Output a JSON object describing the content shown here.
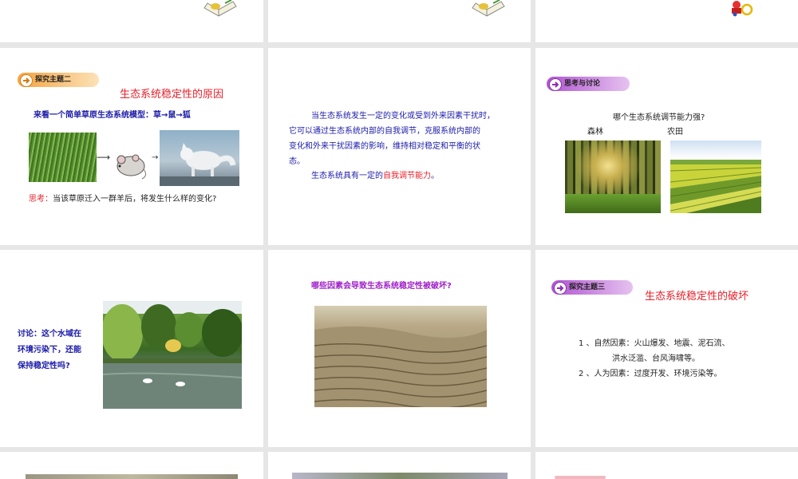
{
  "colors": {
    "topic_title_red": "#e8202a",
    "body_blue": "#1a1aa8",
    "question_purple": "#a020c8",
    "discussion_red": "#e8202a",
    "banner_orange": "#f5a340",
    "banner_purple": "#b054d0"
  },
  "slide4": {
    "banner": "探究主题二",
    "title": "生态系统稳定性的原因",
    "model_text": "来看一个简单草原生态系统模型：草→鼠→狐",
    "arrow1": "⟶",
    "arrow2": "→",
    "think_label": "思考：",
    "think_text": "当该草原迁入一群羊后，将发生什么样的变化?"
  },
  "slide5": {
    "para1_line1": "当生态系统发生一定的变化或受到外来因素干扰时，",
    "para1_line2": "它可以通过生态系统内部的自我调节，克服系统内部的",
    "para1_line3": "变化和外来干扰因素的影响，维持相对稳定和平衡的状",
    "para1_line4": "态。",
    "para2_prefix": "生态系统具有一定的",
    "para2_highlight": "自我调节能力",
    "para2_suffix": "。"
  },
  "slide6": {
    "banner": "思考与讨论",
    "question": "哪个生态系统调节能力强?",
    "label_forest": "森林",
    "label_farm": "农田"
  },
  "slide7": {
    "line1": "讨论：这个水域在",
    "line2": "环境污染下，还能",
    "line3": "保持稳定性吗?"
  },
  "slide8": {
    "question": "哪些因素会导致生态系统稳定性被破坏?"
  },
  "slide9": {
    "banner": "探究主题三",
    "title": "生态系统稳定性的破坏",
    "item1_line1": "1 、自然因素：火山爆发、地震、泥石流、",
    "item1_line2": "洪水泛滥、台风海啸等。",
    "item2": "2 、人为因素：过度开发、环境污染等。"
  },
  "icons": {
    "book_icon": "open-book-icon",
    "cartoon_icon": "cartoon-figure-icon",
    "banner_icon": "arrow-ball-icon"
  }
}
